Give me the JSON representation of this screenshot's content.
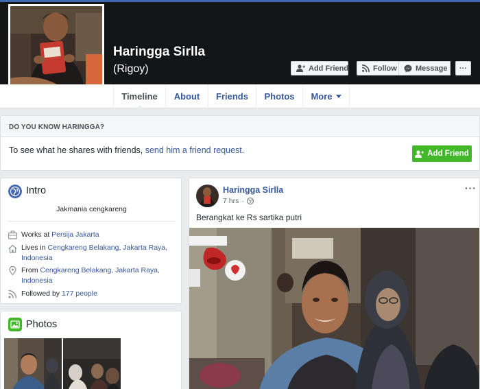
{
  "profile": {
    "name": "Haringga Sirlla",
    "nickname": "(Rigoy)"
  },
  "cover_buttons": {
    "add_friend": "Add Friend",
    "follow": "Follow",
    "message": "Message",
    "more": "···"
  },
  "tabs": [
    {
      "label": "Timeline",
      "active": true
    },
    {
      "label": "About"
    },
    {
      "label": "Friends"
    },
    {
      "label": "Photos"
    },
    {
      "label": "More"
    }
  ],
  "know_box": {
    "heading": "DO YOU KNOW HARINGGA?",
    "text_prefix": "To see what he shares with friends, ",
    "link": "send him a friend request.",
    "button": "Add Friend"
  },
  "intro": {
    "title": "Intro",
    "bio": "Jakmania cengkareng",
    "works_prefix": "Works at ",
    "works_link": "Persija Jakarta",
    "lives_prefix": "Lives in ",
    "lives_link": "Cengkareng Belakang, Jakarta Raya, Indonesia",
    "from_prefix": "From ",
    "from_link": "Cengkareng Belakang, Jakarta Raya, Indonesia",
    "followed_prefix": "Followed by ",
    "followed_link": "177 people"
  },
  "photos": {
    "title": "Photos"
  },
  "post": {
    "author": "Haringga Sirlla",
    "time": "7 hrs",
    "separator": "·",
    "text": "Berangkat ke Rs sartika putri",
    "more": "···"
  },
  "colors": {
    "facebook_blue": "#4267b2",
    "link": "#365899",
    "green_button": "#42b72a",
    "background": "#e9ebee"
  }
}
